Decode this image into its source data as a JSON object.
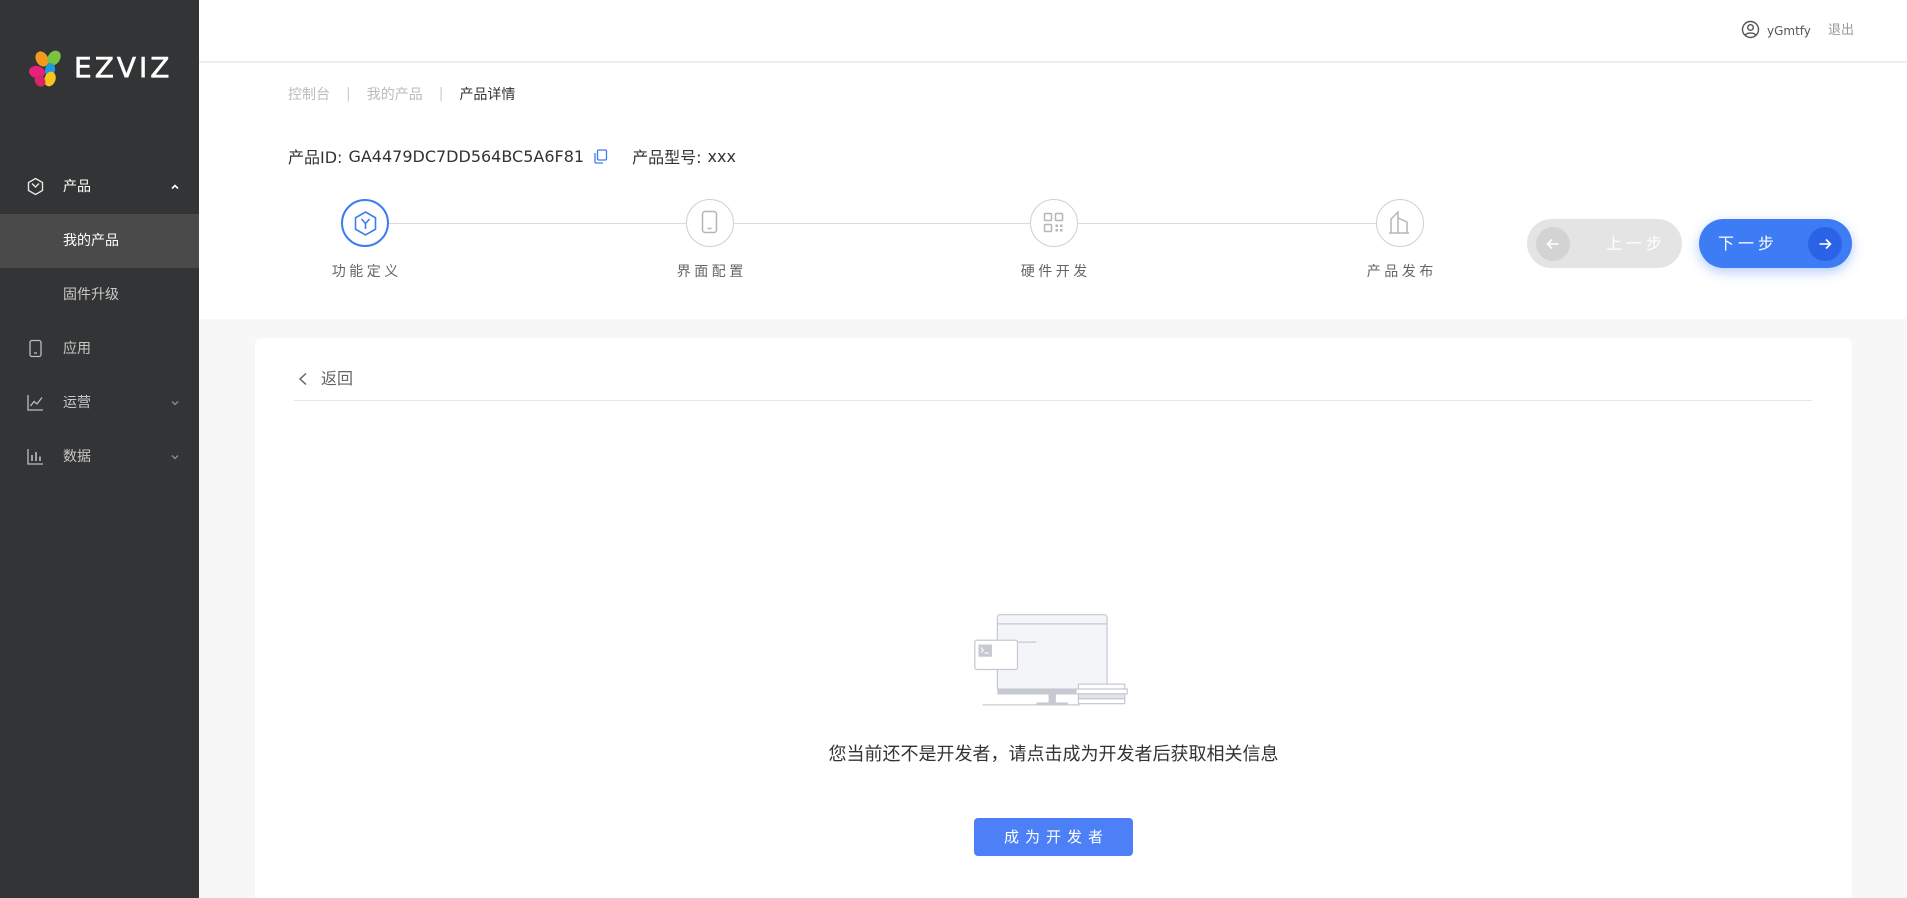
{
  "app": {
    "logo_text": "EZVIZ",
    "logo_icon": "ezviz-petals-logo"
  },
  "header": {
    "username": "yGmtfy",
    "user_icon": "user-circle-icon",
    "logout_label": "退出"
  },
  "sidebar": {
    "product": {
      "label": "产品",
      "icon": "cube-icon",
      "expanded": true,
      "children": [
        {
          "label": "我的产品",
          "active": true
        },
        {
          "label": "固件升级",
          "active": false
        }
      ]
    },
    "app": {
      "label": "应用",
      "icon": "phone-icon"
    },
    "operations": {
      "label": "运营",
      "icon": "line-chart-icon",
      "expanded": false
    },
    "data": {
      "label": "数据",
      "icon": "bar-chart-icon",
      "expanded": false
    }
  },
  "breadcrumb": {
    "separator": "|",
    "items": [
      {
        "label": "控制台"
      },
      {
        "label": "我的产品"
      },
      {
        "label": "产品详情"
      }
    ]
  },
  "product": {
    "id_label": "产品ID:",
    "id_value": "GA4479DC7DD564BC5A6F81",
    "copy_icon": "copy-icon",
    "model_label": "产品型号:",
    "model_value": "xxx"
  },
  "steps": [
    {
      "label": "功能定义",
      "icon": "hexagon-y-icon",
      "active": true
    },
    {
      "label": "界面配置",
      "icon": "tablet-icon",
      "active": false
    },
    {
      "label": "硬件开发",
      "icon": "grid-icon",
      "active": false
    },
    {
      "label": "产品发布",
      "icon": "building-icon",
      "active": false
    }
  ],
  "step_nav": {
    "prev_label": "上一步",
    "prev_enabled": false,
    "next_label": "下一步",
    "next_enabled": true
  },
  "content": {
    "back_label": "返回",
    "empty_message": "您当前还不是开发者，请点击成为开发者后获取相关信息",
    "cta_label": "成为开发者",
    "illustration": "empty-state-computer-illustration"
  },
  "colors": {
    "primary": "#3d7cf5",
    "sidebar_bg": "#333435",
    "sidebar_active_bg": "#4a4a4b",
    "cta_bg": "#4d80f7"
  }
}
